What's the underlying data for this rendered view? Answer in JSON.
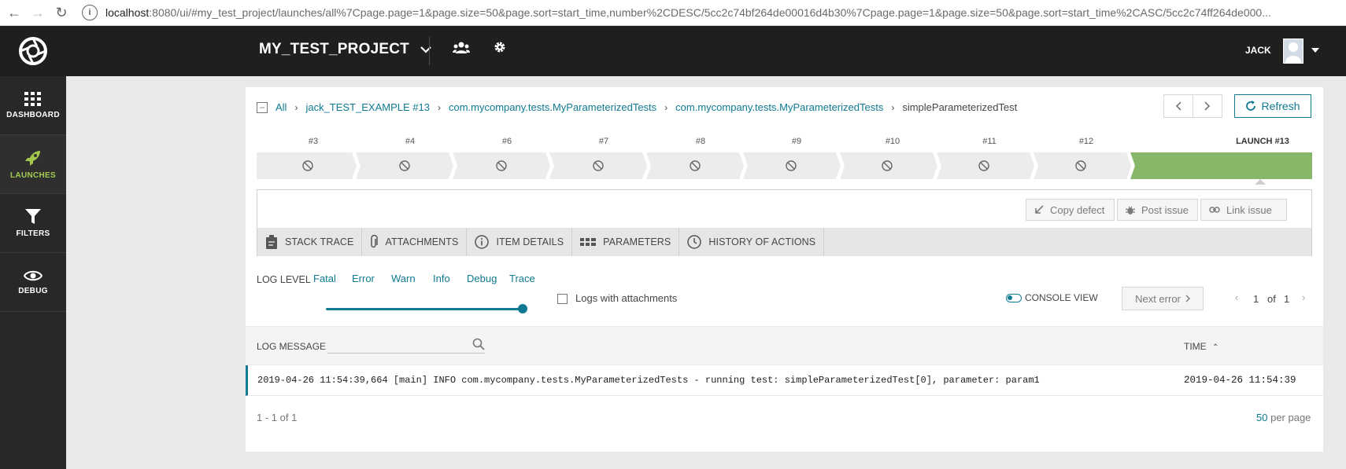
{
  "browser": {
    "url_host": "localhost",
    "url_rest": ":8080/ui/#my_test_project/launches/all%7Cpage.page=1&page.size=50&page.sort=start_time,number%2CDESC/5cc2c74bf264de00016d4b30%7Cpage.page=1&page.size=50&page.sort=start_time%2CASC/5cc2c74ff264de000..."
  },
  "sidebar": {
    "items": [
      {
        "label": "DASHBOARD",
        "icon": "dashboard-grid-icon"
      },
      {
        "label": "LAUNCHES",
        "icon": "rocket-icon"
      },
      {
        "label": "FILTERS",
        "icon": "filter-icon"
      },
      {
        "label": "DEBUG",
        "icon": "eye-icon"
      }
    ]
  },
  "header": {
    "project": "MY_TEST_PROJECT",
    "user": "JACK"
  },
  "breadcrumbs": {
    "items": [
      "All",
      "jack_TEST_EXAMPLE #13",
      "com.mycompany.tests.MyParameterizedTests",
      "com.mycompany.tests.MyParameterizedTests"
    ],
    "current": "simpleParameterizedTest"
  },
  "toolbar": {
    "refresh": "Refresh"
  },
  "history": {
    "items": [
      "#3",
      "#4",
      "#6",
      "#7",
      "#8",
      "#9",
      "#10",
      "#11",
      "#12",
      "LAUNCH #13"
    ],
    "colors": {
      "skipped": "#ececec",
      "current": "#87b86a"
    }
  },
  "defect": {
    "copy_defect": "Copy defect",
    "post_issue": "Post issue",
    "link_issue": "Link issue"
  },
  "tabs": [
    "STACK TRACE",
    "ATTACHMENTS",
    "ITEM DETAILS",
    "PARAMETERS",
    "HISTORY OF ACTIONS"
  ],
  "log_controls": {
    "label": "LOG LEVEL",
    "levels": [
      "Fatal",
      "Error",
      "Warn",
      "Info",
      "Debug",
      "Trace"
    ],
    "selected_level": "Trace",
    "logs_with_attachments": "Logs with attachments",
    "logs_with_attachments_checked": false,
    "console_view": "CONSOLE VIEW",
    "next_error": "Next error",
    "page_current": "1",
    "page_of": "of",
    "page_total": "1"
  },
  "table": {
    "col_message": "LOG MESSAGE",
    "col_time": "TIME",
    "rows": [
      {
        "message": "2019-04-26 11:54:39,664 [main] INFO com.mycompany.tests.MyParameterizedTests - running test: simpleParameterizedTest[0], parameter: param1",
        "time": "2019-04-26 11:54:39"
      }
    ]
  },
  "footer": {
    "range": "1 - 1 of 1",
    "per_page_value": "50",
    "per_page_label": "per page"
  },
  "colors": {
    "accent": "#0f7a91",
    "sidebar_active": "#a2c94e",
    "sidebar_bg": "#282828"
  }
}
